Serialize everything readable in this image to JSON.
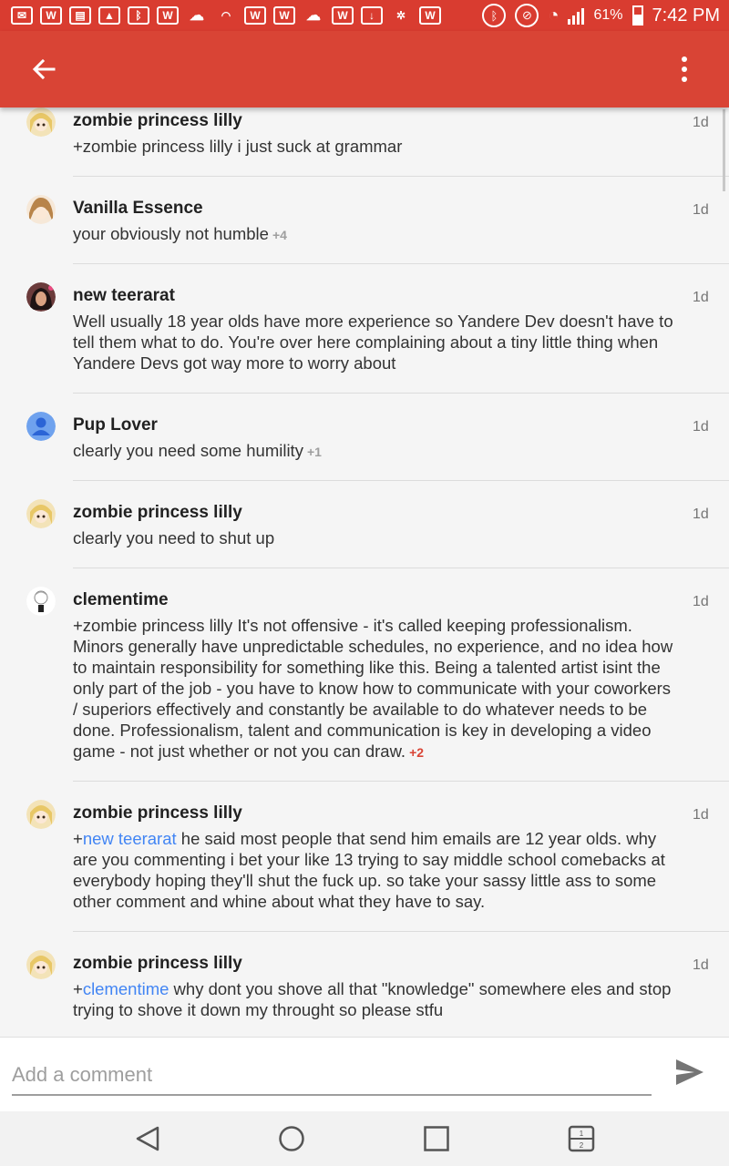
{
  "status_bar": {
    "left_icons": [
      "mail-icon",
      "w-app-icon",
      "clipboard-icon",
      "image-icon",
      "bluetooth-device-icon",
      "w-app-icon",
      "cloud-icon",
      "wifi-icon",
      "w-app-icon",
      "w-app-icon",
      "cloud-icon",
      "w-app-icon",
      "download-icon",
      "fan-icon",
      "w-app-icon"
    ],
    "battery": "61%",
    "time": "7:42 PM"
  },
  "toolbar": {
    "back_icon": "arrow-back-icon",
    "menu_icon": "more-vert-icon",
    "color": "#d94435"
  },
  "comments": [
    {
      "author": "zombie princess lilly",
      "time": "1d",
      "text": "+zombie princess lilly i just suck at grammar",
      "avatar": "avatar-anime-blonde"
    },
    {
      "author": "Vanilla Essence",
      "time": "1d",
      "text": "your obviously not humble",
      "plus": "+4",
      "avatar": "avatar-anime-brown"
    },
    {
      "author": "new teerarat",
      "time": "1d",
      "text": "Well usually 18 year olds have more experience so Yandere Dev doesn't have to tell them what to do. You're over here complaining about a tiny little thing when Yandere Devs got way more to worry about",
      "avatar": "avatar-photo-girl"
    },
    {
      "author": "Pup Lover",
      "time": "1d",
      "text": "clearly you need some humility",
      "plus": "+1",
      "avatar": "avatar-default-person"
    },
    {
      "author": "zombie princess lilly",
      "time": "1d",
      "text": "clearly you need to shut up",
      "avatar": "avatar-anime-blonde"
    },
    {
      "author": "clementime",
      "time": "1d",
      "text": "+zombie princess lilly It's not offensive - it's called keeping professionalism. Minors generally have unpredictable schedules, no experience, and no idea how to maintain responsibility for something like this. Being a talented artist isint the only part of the job - you have to know how to communicate with your coworkers / superiors effectively and constantly be available to do whatever needs to be done. Professionalism, talent and communication is key in developing a video game - not just whether or not you can draw.",
      "plus": "+2",
      "avatar": "avatar-sketch"
    },
    {
      "author": "zombie princess lilly",
      "time": "1d",
      "mention": "new teerarat",
      "text": " he said most people that send him emails are 12 year olds. why are you commenting  i bet your like 13 trying to say middle school comebacks at everybody hoping they'll shut the fuck up. so take your sassy little ass to some other comment and whine about what they have to say.",
      "avatar": "avatar-anime-blonde"
    },
    {
      "author": "zombie princess lilly",
      "time": "1d",
      "mention": "clementime",
      "text": " why dont you shove all that \"knowledge\"  somewhere eles and stop trying to shove it down my throught so please stfu",
      "avatar": "avatar-anime-blonde"
    }
  ],
  "compose": {
    "placeholder": "Add a comment",
    "send_icon": "send-icon"
  },
  "nav_bar": {
    "back_icon": "nav-back-icon",
    "home_icon": "nav-home-icon",
    "recents_icon": "nav-recents-icon",
    "multiwindow_icon": "nav-multiwindow-icon"
  }
}
